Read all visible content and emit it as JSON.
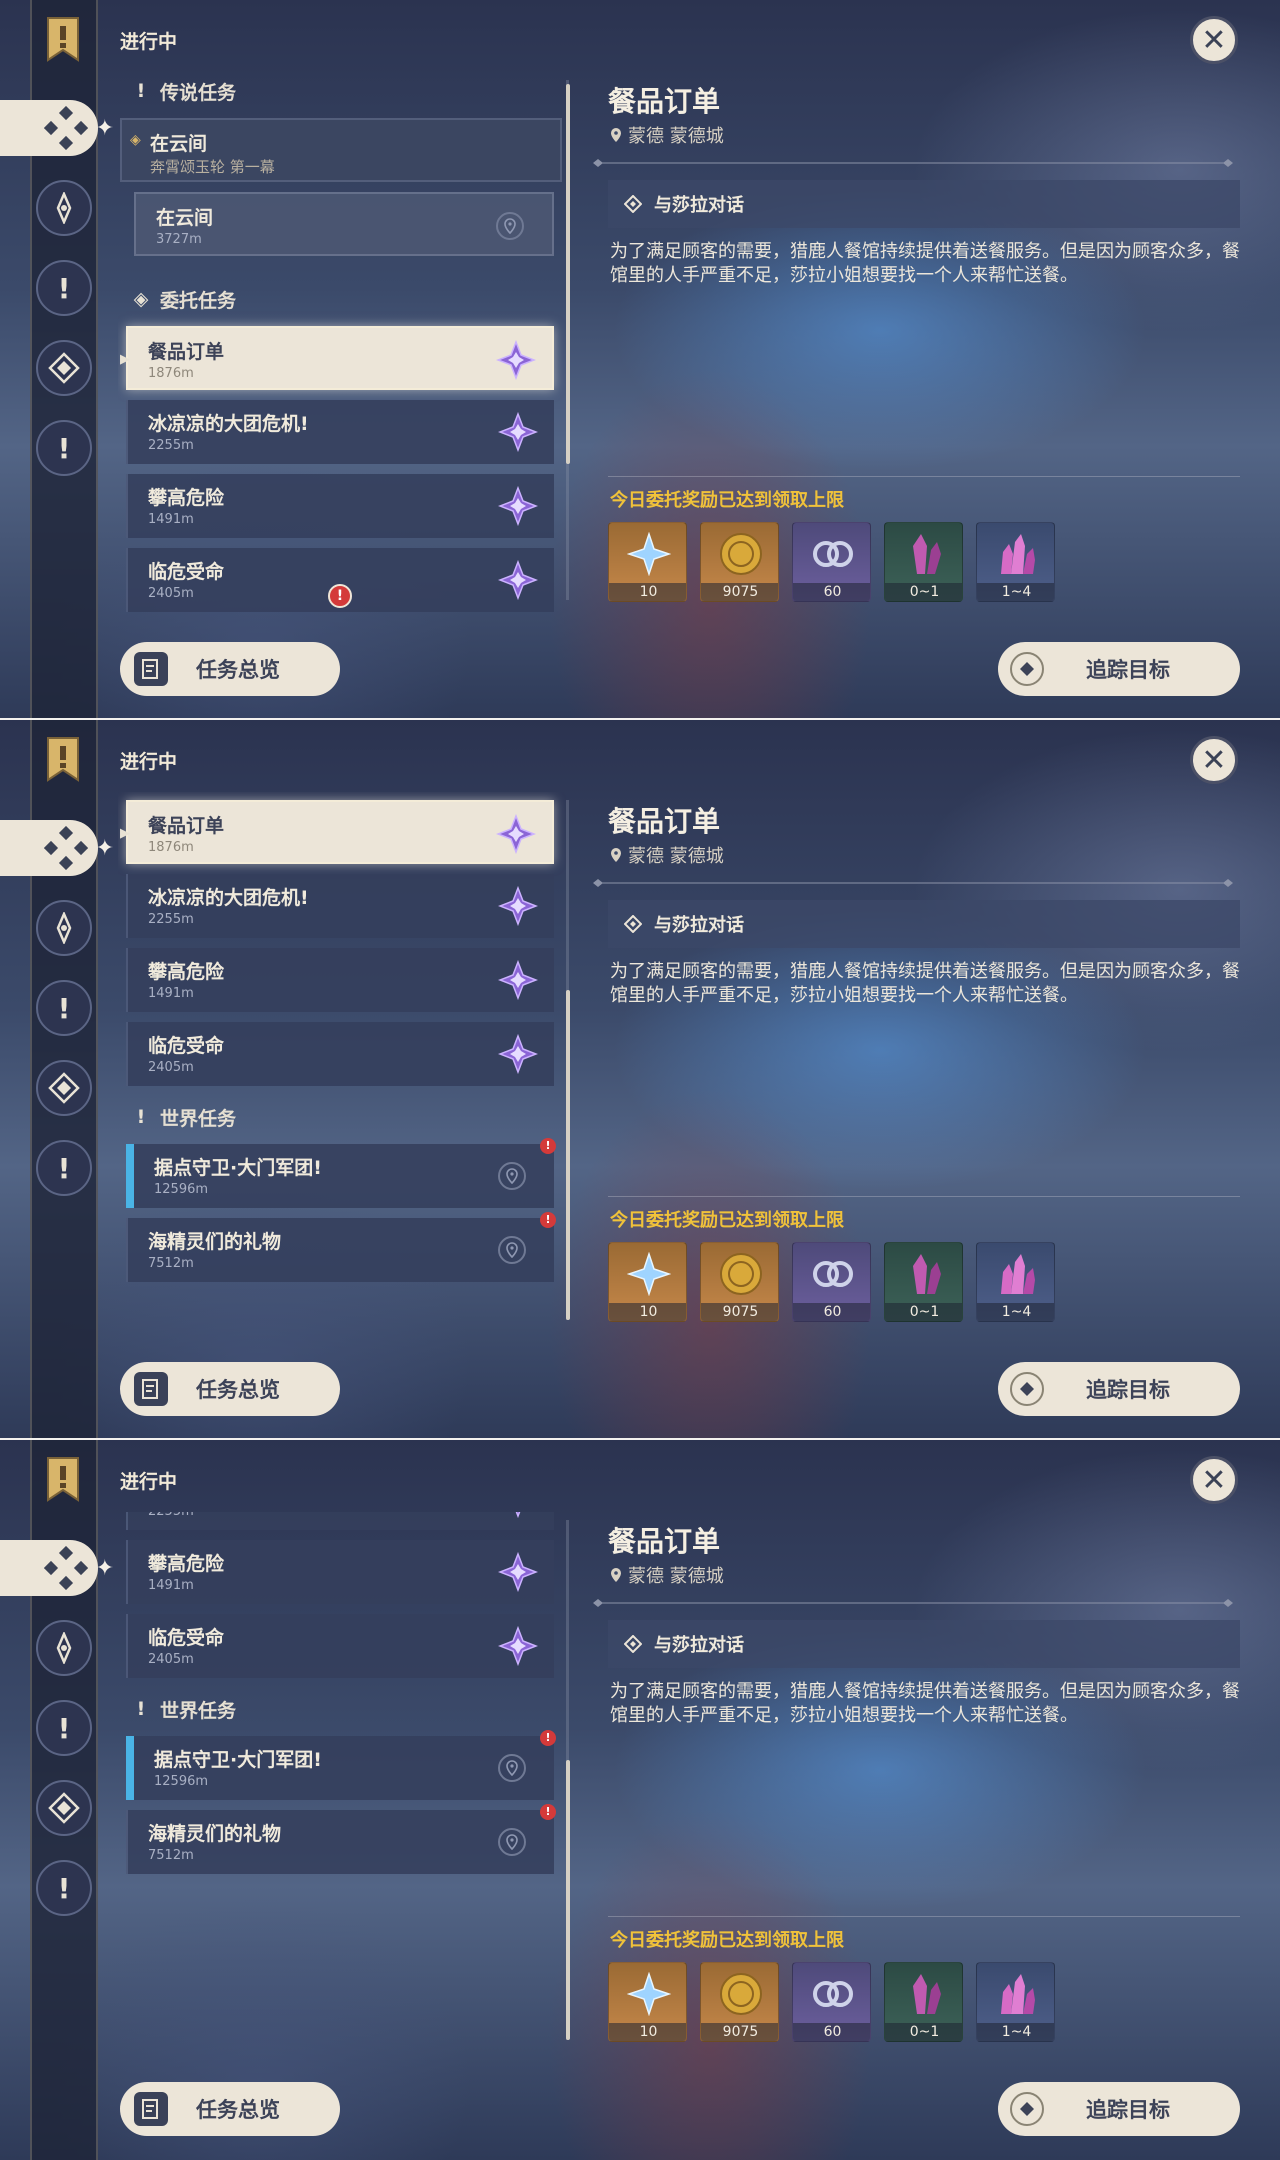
{
  "header": {
    "status_label": "进行中"
  },
  "sections": {
    "archon": "传说任务",
    "commission": "委托任务",
    "world": "世界任务"
  },
  "quests": {
    "story": {
      "title": "在云间",
      "subtitle": "奔霄颂玉轮 第一幕"
    },
    "story_sub": {
      "title": "在云间",
      "distance": "3727m"
    },
    "meal": {
      "title": "餐品订单",
      "distance": "1876m"
    },
    "frost": {
      "title": "冰凉凉的大团危机!",
      "distance": "2255m"
    },
    "climb": {
      "title": "攀高危险",
      "distance": "1491m"
    },
    "rescue": {
      "title": "临危受命",
      "distance": "2405m"
    },
    "outpost": {
      "title": "据点守卫·大门军团!",
      "distance": "12596m"
    },
    "gift": {
      "title": "海精灵们的礼物",
      "distance": "7512m"
    }
  },
  "buttons": {
    "overview": "任务总览",
    "track": "追踪目标"
  },
  "detail": {
    "title": "餐品订单",
    "location": "蒙德 蒙德城",
    "objective": "与莎拉对话",
    "description": "为了满足顾客的需要，猎鹿人餐馆持续提供着送餐服务。但是因为顾客众多，餐馆里的人手严重不足，莎拉小姐想要找一个人来帮忙送餐。",
    "reward_notice": "今日委托奖励已达到领取上限",
    "rewards": [
      {
        "icon": "primogem-icon",
        "count": "10"
      },
      {
        "icon": "mora-icon",
        "count": "9075"
      },
      {
        "icon": "companionship-exp-icon",
        "count": "60"
      },
      {
        "icon": "ore-crystal-icon",
        "count": "0~1"
      },
      {
        "icon": "amethyst-crystal-icon",
        "count": "1~4"
      }
    ]
  },
  "colors": {
    "accent_cream": "#ece5d8",
    "reward_notice": "#f0c23a",
    "alert_red": "#d43a3a",
    "world_marker": "#4ab4e6"
  }
}
